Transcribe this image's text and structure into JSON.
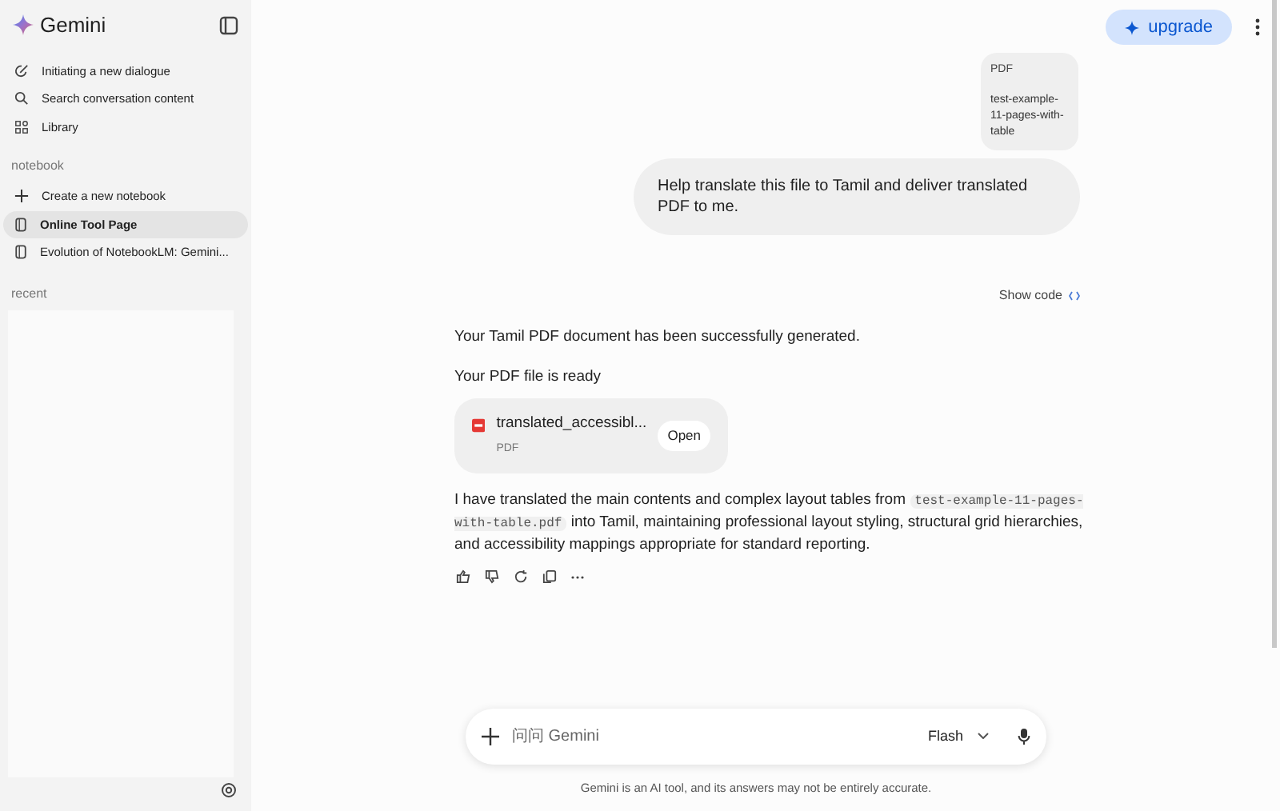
{
  "sidebar": {
    "app_name": "Gemini",
    "nav_items": [
      {
        "label": "Initiating a new dialogue",
        "kind": "new-chat"
      },
      {
        "label": "Search conversation content",
        "kind": "search"
      },
      {
        "label": "Library",
        "kind": "library"
      }
    ],
    "notebook_heading": "notebook",
    "notebook_items": [
      {
        "label": "Create a new notebook",
        "kind": "create",
        "selected": false
      },
      {
        "label": "Online Tool Page",
        "kind": "notebook",
        "selected": true
      },
      {
        "label": "Evolution of NotebookLM: Gemini...",
        "kind": "notebook",
        "selected": false
      }
    ],
    "recent_heading": "recent"
  },
  "header": {
    "upgrade_label": "upgrade"
  },
  "user_message": {
    "attachment": {
      "type": "PDF",
      "name": "test-example-11-pages-with-table"
    },
    "text": "Help translate this file to Tamil and deliver translated PDF to me."
  },
  "response": {
    "show_code": "Show code",
    "intro": "Your Tamil PDF document has been successfully generated.",
    "ready": "Your PDF file is ready",
    "file": {
      "name": "translated_accessibl...",
      "type": "PDF",
      "open_label": "Open"
    },
    "body": [
      {
        "kind": "text",
        "text": "I have translated the main contents and complex layout tables from "
      },
      {
        "kind": "code",
        "text": "test-example-11-pages-with-table.pdf"
      },
      {
        "kind": "text",
        "text": " into Tamil, maintaining professional layout styling, structural grid hierarchies, and accessibility mappings appropriate for standard reporting."
      }
    ]
  },
  "composer": {
    "placeholder": "问问 Gemini",
    "model": "Flash"
  },
  "disclaimer": "Gemini is an AI tool, and its answers may not be entirely accurate."
}
